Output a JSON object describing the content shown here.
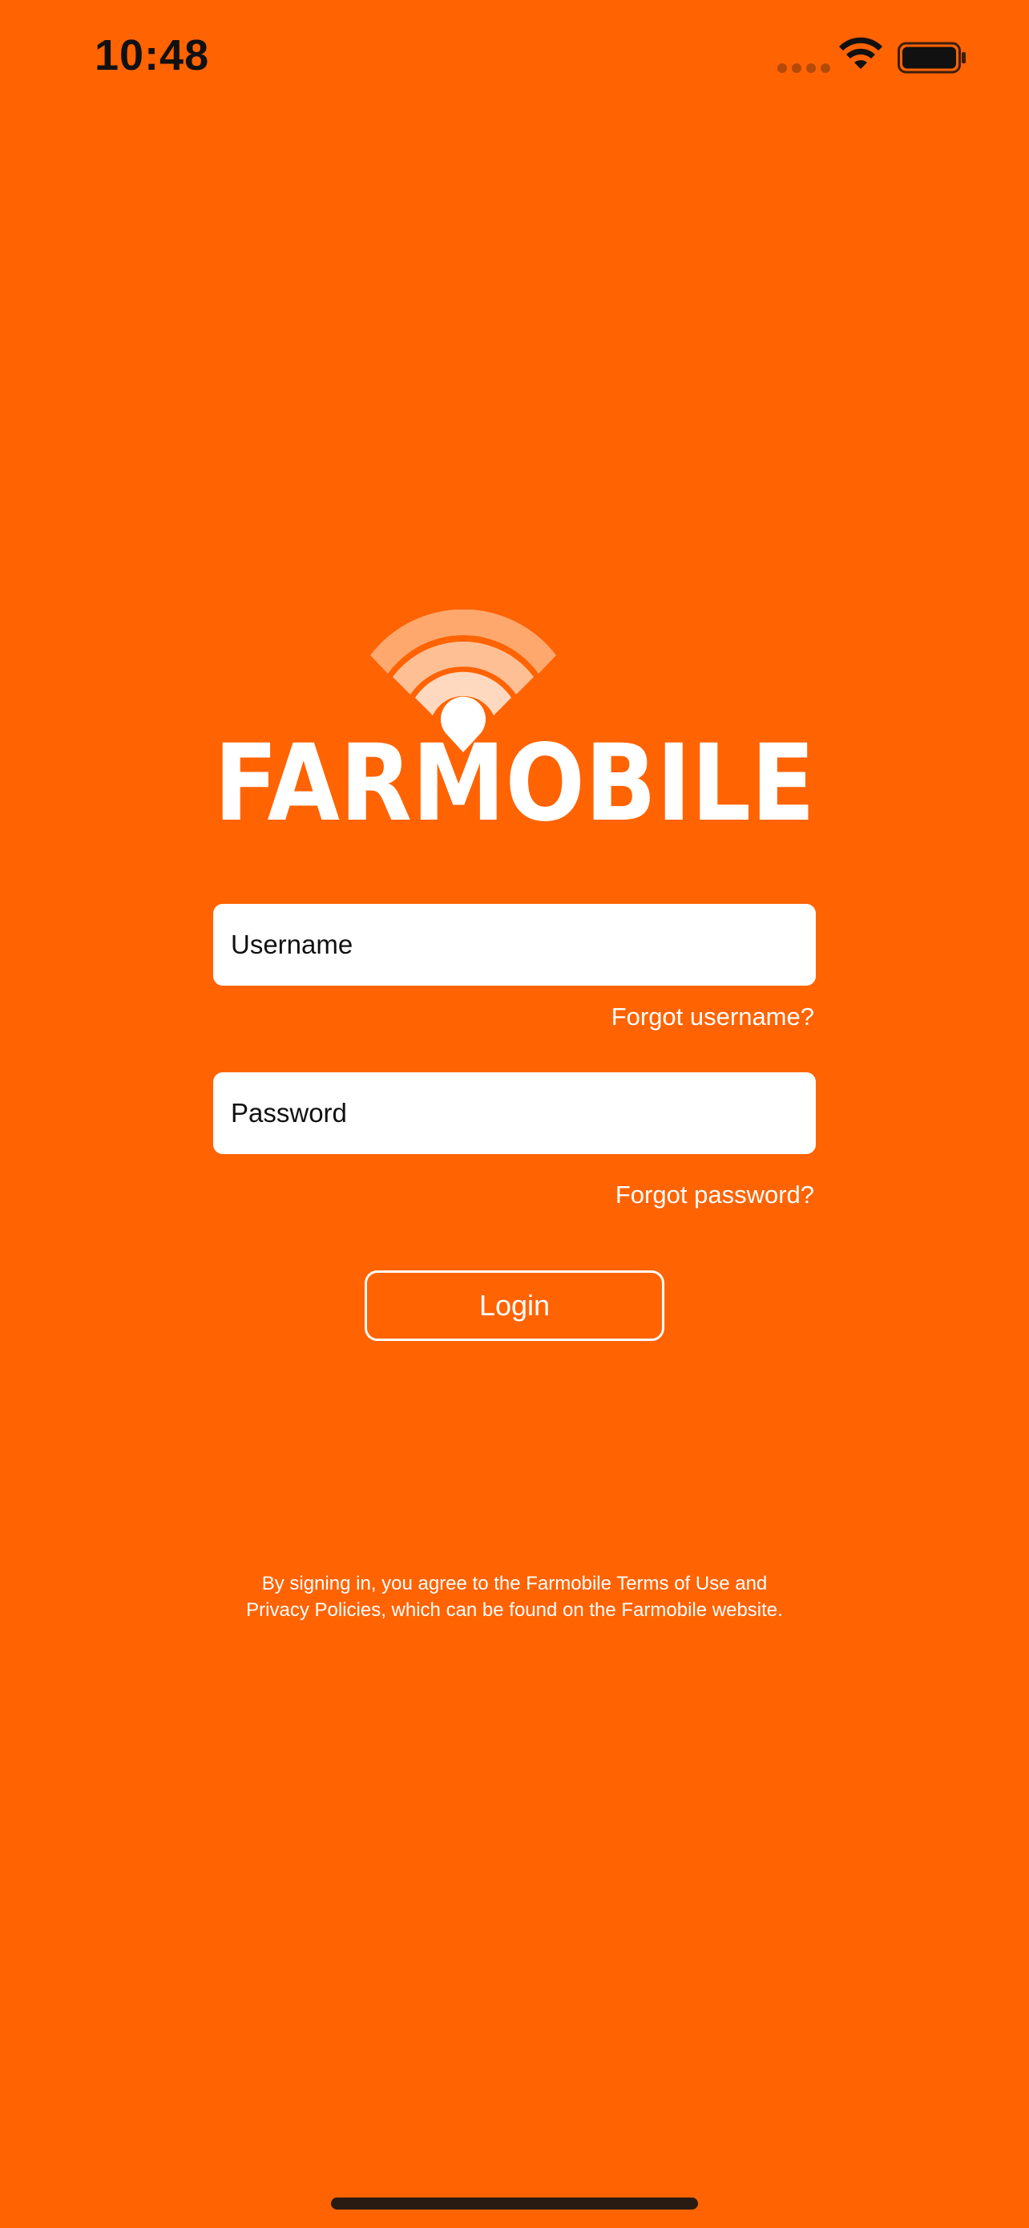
{
  "status_bar": {
    "time": "10:48",
    "wifi_icon": "wifi-icon",
    "battery_icon": "battery-icon"
  },
  "brand": {
    "logo_text": "FARMOBILE",
    "logo_icon": "signal-waves-icon",
    "background_color": "#FF6302",
    "accent_color": "#FFFFFF"
  },
  "login_form": {
    "username_placeholder": "Username",
    "username_value": "",
    "forgot_username_label": "Forgot username?",
    "password_placeholder": "Password",
    "password_value": "",
    "forgot_password_label": "Forgot password?",
    "login_label": "Login"
  },
  "terms": {
    "line1": "By signing in, you agree to the Farmobile Terms of Use and",
    "line2": "Privacy Policies, which can be found on the Farmobile website."
  }
}
